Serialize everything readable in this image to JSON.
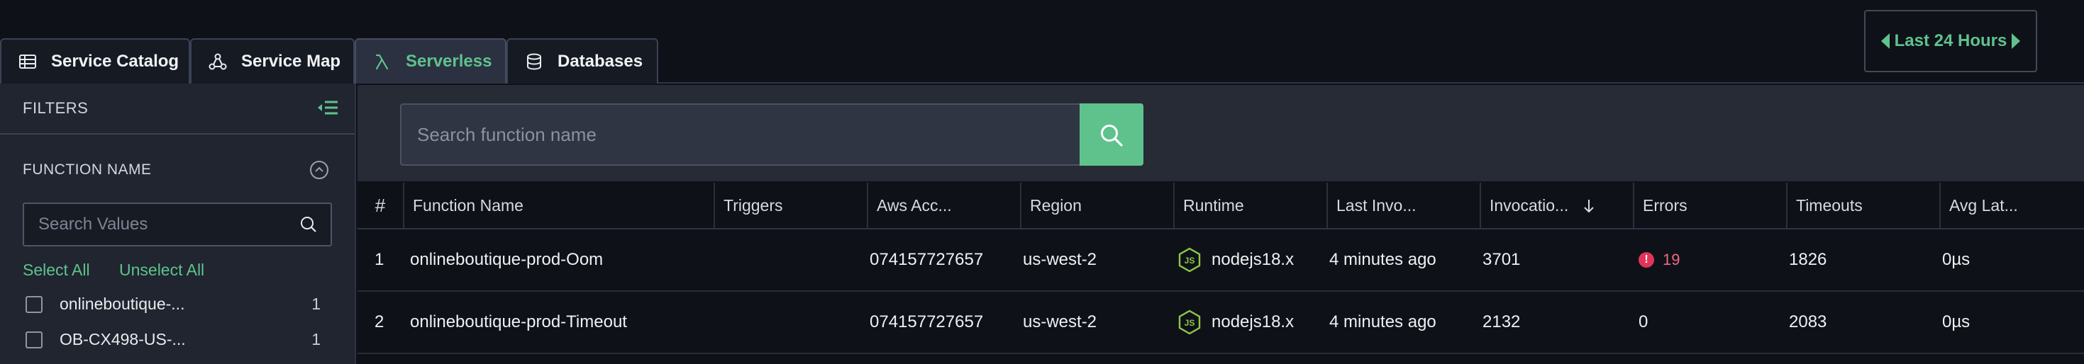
{
  "tabs": [
    {
      "label": "Service Catalog",
      "icon": "table-icon",
      "active": false
    },
    {
      "label": "Service Map",
      "icon": "graph-icon",
      "active": false
    },
    {
      "label": "Serverless",
      "icon": "lambda-icon",
      "active": true
    },
    {
      "label": "Databases",
      "icon": "database-icon",
      "active": false
    }
  ],
  "time_range": {
    "label": "Last 24 Hours"
  },
  "sidebar": {
    "filters_title": "FILTERS",
    "section_title": "FUNCTION NAME",
    "search_placeholder": "Search Values",
    "select_all": "Select All",
    "unselect_all": "Unselect All",
    "items": [
      {
        "label": "onlineboutique-...",
        "count": "1",
        "checked": false
      },
      {
        "label": "OB-CX498-US-...",
        "count": "1",
        "checked": false
      }
    ]
  },
  "search": {
    "placeholder": "Search function name"
  },
  "table": {
    "columns": [
      "#",
      "Function Name",
      "Triggers",
      "Aws Acc...",
      "Region",
      "Runtime",
      "Last Invo...",
      "Invocatio...",
      "Errors",
      "Timeouts",
      "Avg Lat..."
    ],
    "sorted_column": "Invocatio...",
    "sort_direction": "descending",
    "rows": [
      {
        "num": "1",
        "name": "onlineboutique-prod-Oom",
        "triggers": "",
        "account": "074157727657",
        "region": "us-west-2",
        "runtime": "nodejs18.x",
        "last": "4 minutes ago",
        "invocations": "3701",
        "errors": "19",
        "has_error": true,
        "timeouts": "1826",
        "avg_latency": "0µs"
      },
      {
        "num": "2",
        "name": "onlineboutique-prod-Timeout",
        "triggers": "",
        "account": "074157727657",
        "region": "us-west-2",
        "runtime": "nodejs18.x",
        "last": "4 minutes ago",
        "invocations": "2132",
        "errors": "0",
        "has_error": false,
        "timeouts": "2083",
        "avg_latency": "0µs"
      }
    ]
  },
  "colors": {
    "accent": "#5fc28d",
    "error": "#e0355a",
    "background": "#0f1118",
    "panel": "#20252f"
  }
}
